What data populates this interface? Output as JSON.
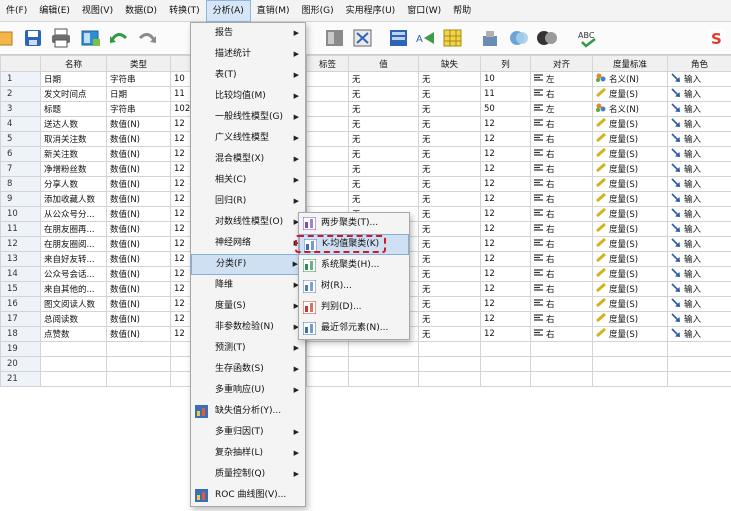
{
  "menubar": {
    "items": [
      "件(F)",
      "编辑(E)",
      "视图(V)",
      "数据(D)",
      "转换(T)",
      "分析(A)",
      "直销(M)",
      "图形(G)",
      "实用程序(U)",
      "窗口(W)",
      "帮助"
    ]
  },
  "toolbar": {
    "spell_label": "ABC"
  },
  "grid": {
    "headers": [
      "",
      "名称",
      "类型",
      "",
      "",
      "标签",
      "值",
      "缺失",
      "列",
      "对齐",
      "度量标准",
      "角色"
    ],
    "rows": [
      {
        "n": "1",
        "name": "日期",
        "type": "字符串",
        "w": "10",
        "value": "无",
        "missing": "无",
        "cols": "10",
        "align": "左",
        "measure": "名义(N)",
        "role": "输入"
      },
      {
        "n": "2",
        "name": "发文时间点",
        "type": "日期",
        "w": "11",
        "value": "无",
        "missing": "无",
        "cols": "11",
        "align": "右",
        "measure": "度量(S)",
        "role": "输入"
      },
      {
        "n": "3",
        "name": "标题",
        "type": "字符串",
        "w": "102",
        "value": "无",
        "missing": "无",
        "cols": "50",
        "align": "左",
        "measure": "名义(N)",
        "role": "输入"
      },
      {
        "n": "4",
        "name": "送达人数",
        "type": "数值(N)",
        "w": "12",
        "value": "无",
        "missing": "无",
        "cols": "12",
        "align": "右",
        "measure": "度量(S)",
        "role": "输入"
      },
      {
        "n": "5",
        "name": "取消关注数",
        "type": "数值(N)",
        "w": "12",
        "value": "无",
        "missing": "无",
        "cols": "12",
        "align": "右",
        "measure": "度量(S)",
        "role": "输入"
      },
      {
        "n": "6",
        "name": "新关注数",
        "type": "数值(N)",
        "w": "12",
        "value": "无",
        "missing": "无",
        "cols": "12",
        "align": "右",
        "measure": "度量(S)",
        "role": "输入"
      },
      {
        "n": "7",
        "name": "净增粉丝数",
        "type": "数值(N)",
        "w": "12",
        "value": "无",
        "missing": "无",
        "cols": "12",
        "align": "右",
        "measure": "度量(S)",
        "role": "输入"
      },
      {
        "n": "8",
        "name": "分享人数",
        "type": "数值(N)",
        "w": "12",
        "value": "无",
        "missing": "无",
        "cols": "12",
        "align": "右",
        "measure": "度量(S)",
        "role": "输入"
      },
      {
        "n": "9",
        "name": "添加收藏人数",
        "type": "数值(N)",
        "w": "12",
        "value": "无",
        "missing": "无",
        "cols": "12",
        "align": "右",
        "measure": "度量(S)",
        "role": "输入"
      },
      {
        "n": "10",
        "name": "从公众号分...",
        "type": "数值(N)",
        "w": "12",
        "value": "无",
        "missing": "无",
        "cols": "12",
        "align": "右",
        "measure": "度量(S)",
        "role": "输入"
      },
      {
        "n": "11",
        "name": "在朋友圈再...",
        "type": "数值(N)",
        "w": "12",
        "value": "无",
        "missing": "无",
        "cols": "12",
        "align": "右",
        "measure": "度量(S)",
        "role": "输入"
      },
      {
        "n": "12",
        "name": "在朋友圈阅...",
        "type": "数值(N)",
        "w": "12",
        "value": "无",
        "missing": "无",
        "cols": "12",
        "align": "右",
        "measure": "度量(S)",
        "role": "输入"
      },
      {
        "n": "13",
        "name": "来自好友转...",
        "type": "数值(N)",
        "w": "12",
        "value": "无",
        "missing": "无",
        "cols": "12",
        "align": "右",
        "measure": "度量(S)",
        "role": "输入"
      },
      {
        "n": "14",
        "name": "公众号会话...",
        "type": "数值(N)",
        "w": "12",
        "value": "无",
        "missing": "无",
        "cols": "12",
        "align": "右",
        "measure": "度量(S)",
        "role": "输入"
      },
      {
        "n": "15",
        "name": "来自其他的...",
        "type": "数值(N)",
        "w": "12",
        "value": "无",
        "missing": "无",
        "cols": "12",
        "align": "右",
        "measure": "度量(S)",
        "role": "输入"
      },
      {
        "n": "16",
        "name": "图文阅读人数",
        "type": "数值(N)",
        "w": "12",
        "value": "无",
        "missing": "无",
        "cols": "12",
        "align": "右",
        "measure": "度量(S)",
        "role": "输入"
      },
      {
        "n": "17",
        "name": "总阅读数",
        "type": "数值(N)",
        "w": "12",
        "value": "无",
        "missing": "无",
        "cols": "12",
        "align": "右",
        "measure": "度量(S)",
        "role": "输入"
      },
      {
        "n": "18",
        "name": "点赞数",
        "type": "数值(N)",
        "w": "12",
        "value": "无",
        "missing": "无",
        "cols": "12",
        "align": "右",
        "measure": "度量(S)",
        "role": "输入"
      },
      {
        "n": "19"
      },
      {
        "n": "20"
      },
      {
        "n": "21"
      }
    ]
  },
  "analyze_menu": {
    "items": [
      {
        "label": "报告",
        "sub": true
      },
      {
        "label": "描述统计",
        "sub": true
      },
      {
        "label": "表(T)",
        "sub": true
      },
      {
        "label": "比较均值(M)",
        "sub": true
      },
      {
        "label": "一般线性模型(G)",
        "sub": true
      },
      {
        "label": "广义线性模型",
        "sub": true
      },
      {
        "label": "混合模型(X)",
        "sub": true
      },
      {
        "label": "相关(C)",
        "sub": true
      },
      {
        "label": "回归(R)",
        "sub": true
      },
      {
        "label": "对数线性模型(O)",
        "sub": true
      },
      {
        "label": "神经网络",
        "sub": true
      },
      {
        "label": "分类(F)",
        "sub": true,
        "highlight": true
      },
      {
        "label": "降维",
        "sub": true
      },
      {
        "label": "度量(S)",
        "sub": true
      },
      {
        "label": "非参数检验(N)",
        "sub": true
      },
      {
        "label": "预测(T)",
        "sub": true
      },
      {
        "label": "生存函数(S)",
        "sub": true
      },
      {
        "label": "多重响应(U)",
        "sub": true
      },
      {
        "label": "缺失值分析(Y)...",
        "sub": false,
        "icon": true
      },
      {
        "label": "多重归因(T)",
        "sub": true
      },
      {
        "label": "复杂抽样(L)",
        "sub": true
      },
      {
        "label": "质量控制(Q)",
        "sub": true
      },
      {
        "label": "ROC 曲线图(V)...",
        "sub": false,
        "icon": true
      }
    ]
  },
  "classify_submenu": {
    "items": [
      {
        "label": "两步聚类(T)...",
        "icon": "two-step-cluster-icon",
        "color": "#7a4fb5"
      },
      {
        "label": "K-均值聚类(K)",
        "icon": "k-means-cluster-icon",
        "color": "#3b6fb5",
        "highlight": true
      },
      {
        "label": "系统聚类(H)...",
        "icon": "hierarchical-cluster-icon",
        "color": "#2d8f4e"
      },
      {
        "label": "树(R)...",
        "icon": "tree-icon",
        "color": "#4d7ab8"
      },
      {
        "label": "判别(D)...",
        "icon": "discriminant-icon",
        "color": "#c0392b"
      },
      {
        "label": "最近邻元素(N)...",
        "icon": "nearest-neighbor-icon",
        "color": "#3b6fb5"
      }
    ]
  },
  "colors": {
    "accent": "#d7e6f6",
    "highlight_border": "#d0182a",
    "role_arrow": "#2a5aa8",
    "nominal_icon": "#e0892b",
    "scale_icon": "#d4b21e"
  }
}
